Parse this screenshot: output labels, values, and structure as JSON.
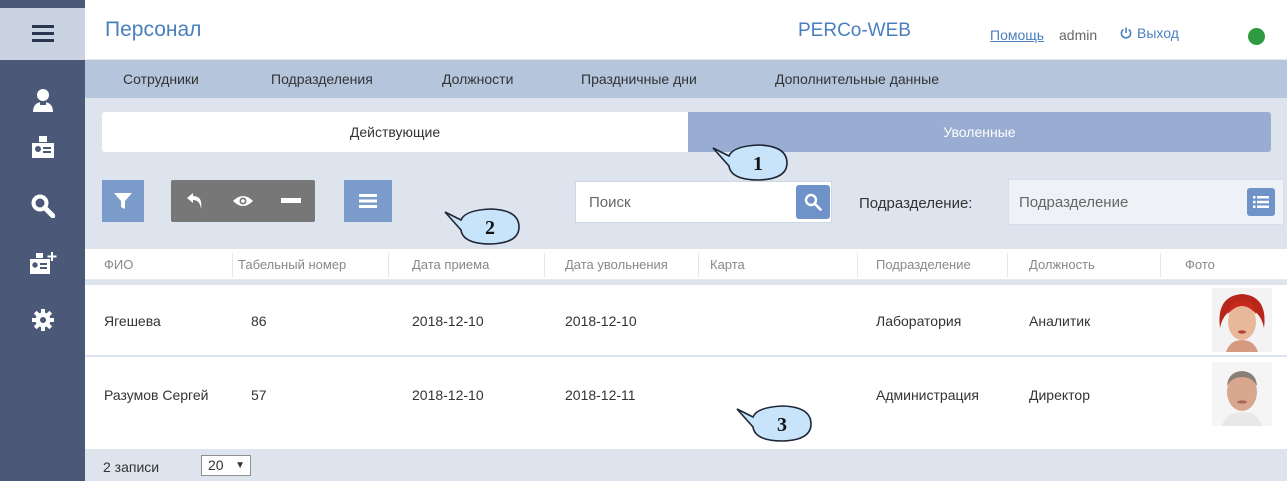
{
  "sidebar": {
    "items": [
      {
        "icon": "menu-icon"
      },
      {
        "icon": "staff-icon"
      },
      {
        "icon": "id-card-icon"
      },
      {
        "icon": "search-icon"
      },
      {
        "icon": "add-card-icon"
      },
      {
        "icon": "gear-icon"
      }
    ]
  },
  "header": {
    "title": "Персонал",
    "brand": "PERCo-WEB",
    "help": "Помощь",
    "user": "admin",
    "logout": "Выход",
    "status_color": "#2e9b43"
  },
  "subnav": {
    "items": [
      "Сотрудники",
      "Подразделения",
      "Должности",
      "Праздничные дни",
      "Дополнительные данные"
    ]
  },
  "tabs": {
    "active": "Действующие",
    "inactive": "Уволенные"
  },
  "toolbar": {
    "filter_icon": "filter-icon",
    "restore_icon": "restore-icon",
    "view_icon": "eye-icon",
    "remove_icon": "minus-icon",
    "menu_icon": "list-icon"
  },
  "search": {
    "placeholder": "Поиск",
    "value": ""
  },
  "division": {
    "label": "Подразделение:",
    "placeholder": "Подразделение"
  },
  "callouts": [
    "1",
    "2",
    "3"
  ],
  "table": {
    "columns": [
      "ФИО",
      "Табельный номер",
      "Дата приема",
      "Дата увольнения",
      "Карта",
      "Подразделение",
      "Должность",
      "Фото"
    ],
    "rows": [
      {
        "name": "Ягешева",
        "tab_no": "86",
        "hired": "2018-12-10",
        "fired": "2018-12-10",
        "card": "",
        "division": "Лаборатория",
        "position": "Аналитик",
        "photo": "female-portrait"
      },
      {
        "name": "Разумов Сергей",
        "tab_no": "57",
        "hired": "2018-12-10",
        "fired": "2018-12-11",
        "card": "",
        "division": "Администрация",
        "position": "Директор",
        "photo": "male-portrait"
      }
    ]
  },
  "footer": {
    "count": "2 записи",
    "page_size": "20"
  },
  "colors": {
    "sidebar": "#4b5877",
    "accent": "#4a7fbe",
    "button": "#7b9bcb",
    "subnav": "#b4c5dc",
    "inactive_tab": "#98add1"
  }
}
